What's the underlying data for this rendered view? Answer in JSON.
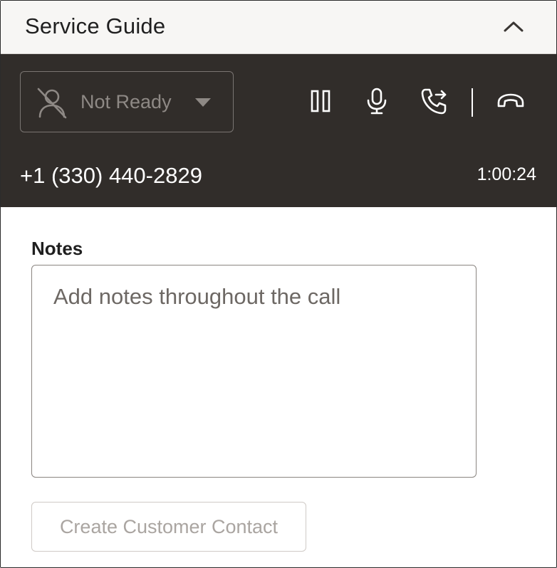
{
  "header": {
    "title": "Service Guide",
    "collapse_icon": "chevron-up-icon"
  },
  "toolbar": {
    "status": {
      "label": "Not Ready",
      "icon": "agent-unavailable-icon",
      "dropdown_icon": "caret-down-icon"
    },
    "buttons": [
      {
        "name": "hold",
        "icon": "pause-icon"
      },
      {
        "name": "mute",
        "icon": "microphone-icon"
      },
      {
        "name": "transfer",
        "icon": "call-transfer-icon"
      },
      {
        "name": "end-call",
        "icon": "hang-up-icon"
      }
    ],
    "phone_number": "+1 (330) 440-2829",
    "timer": "1:00:24"
  },
  "notes": {
    "label": "Notes",
    "placeholder": "Add notes throughout the call",
    "value": ""
  },
  "actions": {
    "create_contact_label": "Create Customer Contact"
  },
  "colors": {
    "toolbar_bg": "#312d2a",
    "header_bg": "#f7f6f4",
    "disabled_text": "#aaa5a1"
  }
}
